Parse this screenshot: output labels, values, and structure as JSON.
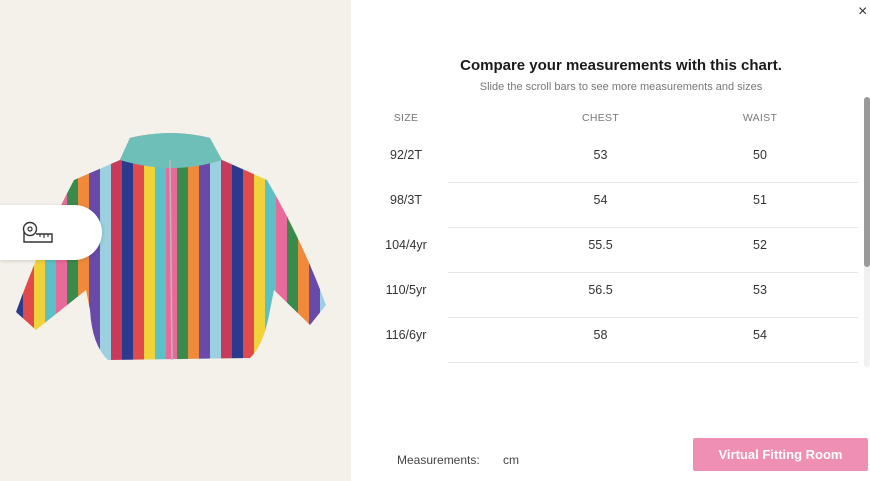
{
  "modal": {
    "title": "Compare your measurements with this chart.",
    "subtitle": "Slide the scroll bars to see more measurements and sizes",
    "close_glyph": "×"
  },
  "product": {
    "image_icon": "striped-puffer-jacket",
    "stripe_colors": [
      "#2b3a8c",
      "#e04a4a",
      "#f2d23a",
      "#5cc1c7",
      "#e86a9a",
      "#3a8a4c",
      "#f08a3a",
      "#6a4aa8",
      "#9ad0e0",
      "#c83a5a"
    ]
  },
  "size_guide_button": {
    "icon": "measuring-tape-icon"
  },
  "table": {
    "headers": [
      "SIZE",
      "CHEST",
      "WAIST"
    ],
    "rows": [
      [
        "92/2T",
        "53",
        "50"
      ],
      [
        "98/3T",
        "54",
        "51"
      ],
      [
        "104/4yr",
        "55.5",
        "52"
      ],
      [
        "110/5yr",
        "56.5",
        "53"
      ],
      [
        "116/6yr",
        "58",
        "54"
      ]
    ]
  },
  "footer": {
    "measurements_label": "Measurements:",
    "unit": "cm",
    "vfr_label": "Virtual Fitting Room",
    "accent_color": "#ef8fb4"
  }
}
